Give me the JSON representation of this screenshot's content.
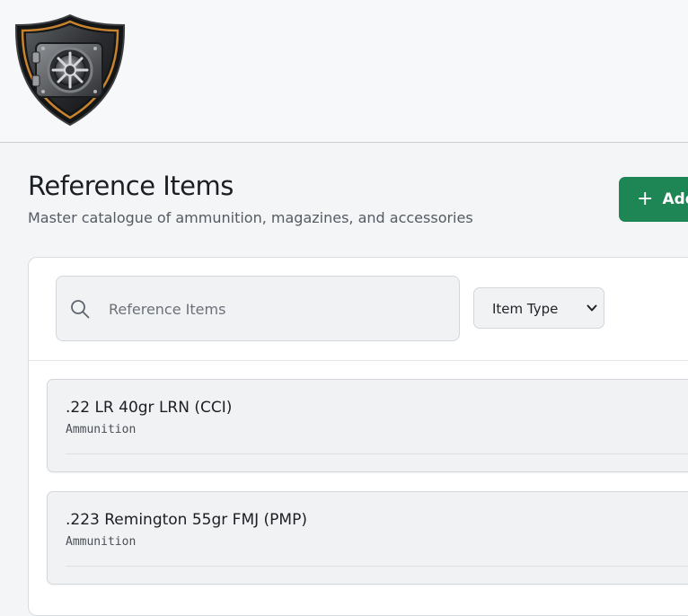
{
  "header": {
    "logo_icon": "vault-shield-logo"
  },
  "page": {
    "title": "Reference Items",
    "subtitle": "Master catalogue of ammunition, magazines, and accessories",
    "add_button_label": "Add",
    "add_button_icon": "plus-icon",
    "accent_color": "#1e8554"
  },
  "filters": {
    "search_placeholder": "Reference Items",
    "search_value": "",
    "search_icon": "search-icon",
    "type_select_value": "Item Type",
    "type_select_icon": "chevron-down-icon"
  },
  "items": [
    {
      "name": ".22 LR 40gr LRN (CCI)",
      "type": "Ammunition"
    },
    {
      "name": ".223 Remington 55gr FMJ (PMP)",
      "type": "Ammunition"
    }
  ]
}
